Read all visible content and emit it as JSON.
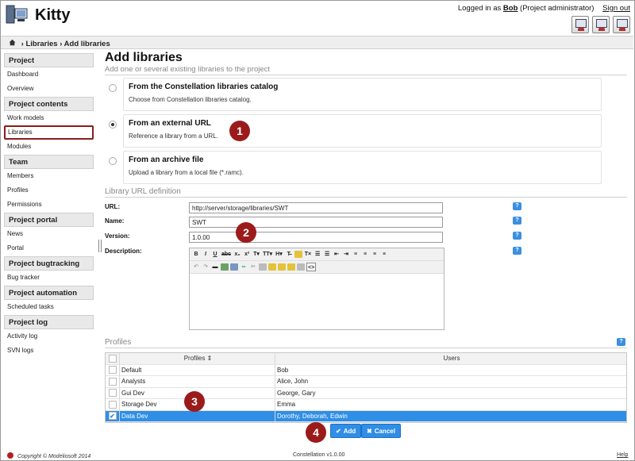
{
  "app": {
    "title": "Kitty"
  },
  "user": {
    "prefix": "Logged in as",
    "name": "Bob",
    "role": "(Project administrator)",
    "signout": "Sign out"
  },
  "breadcrumb": {
    "path": "› Libraries › Add libraries"
  },
  "sidebar": {
    "sections": [
      {
        "title": "Project",
        "items": [
          "Dashboard",
          "Overview"
        ]
      },
      {
        "title": "Project contents",
        "items": [
          "Work models",
          "Libraries",
          "Modules"
        ]
      },
      {
        "title": "Team",
        "items": [
          "Members",
          "Profiles",
          "Permissions"
        ]
      },
      {
        "title": "Project portal",
        "items": [
          "News",
          "Portal"
        ]
      },
      {
        "title": "Project bugtracking",
        "items": [
          "Bug tracker"
        ]
      },
      {
        "title": "Project automation",
        "items": [
          "Scheduled tasks"
        ]
      },
      {
        "title": "Project log",
        "items": [
          "Activity log",
          "SVN logs"
        ]
      }
    ],
    "active_item": "Libraries"
  },
  "main": {
    "title": "Add libraries",
    "subtitle": "Add one or several existing libraries to the project",
    "options": [
      {
        "title": "From the Constellation libraries catalog",
        "desc": "Choose from Constellation libraries catalog.",
        "selected": false
      },
      {
        "title": "From an external URL",
        "desc": "Reference a library from a URL.",
        "selected": true
      },
      {
        "title": "From an archive file",
        "desc": "Upload a library from a local file (*.ramc).",
        "selected": false
      }
    ],
    "definition_title": "Library URL definition",
    "fields": {
      "url_label": "URL:",
      "url_value": "http://server/storage/libraries/SWT",
      "name_label": "Name:",
      "name_value": "SWT",
      "version_label": "Version:",
      "version_value": "1.0.00",
      "description_label": "Description:"
    },
    "help_glyph": "?",
    "profiles_title": "Profiles",
    "table": {
      "col_profiles": "Profiles ⇕",
      "col_users": "Users",
      "rows": [
        {
          "profile": "Default",
          "users": "Bob",
          "checked": false
        },
        {
          "profile": "Analysts",
          "users": "Alice, John",
          "checked": false
        },
        {
          "profile": "Gui Dev",
          "users": "George, Gary",
          "checked": false
        },
        {
          "profile": "Storage Dev",
          "users": "Emma",
          "checked": false
        },
        {
          "profile": "Data Dev",
          "users": "Dorothy, Deborah, Edwin",
          "checked": true
        }
      ]
    },
    "buttons": {
      "add": "Add",
      "cancel": "Cancel"
    }
  },
  "callouts": [
    "1",
    "2",
    "3",
    "4"
  ],
  "footer": {
    "copyright": "Copyright © Modeliosoft 2014",
    "version": "Constellation v1.0.00",
    "help": "Help"
  },
  "colors": {
    "accent": "#2f8ee6",
    "callout": "#9b1b1b"
  }
}
